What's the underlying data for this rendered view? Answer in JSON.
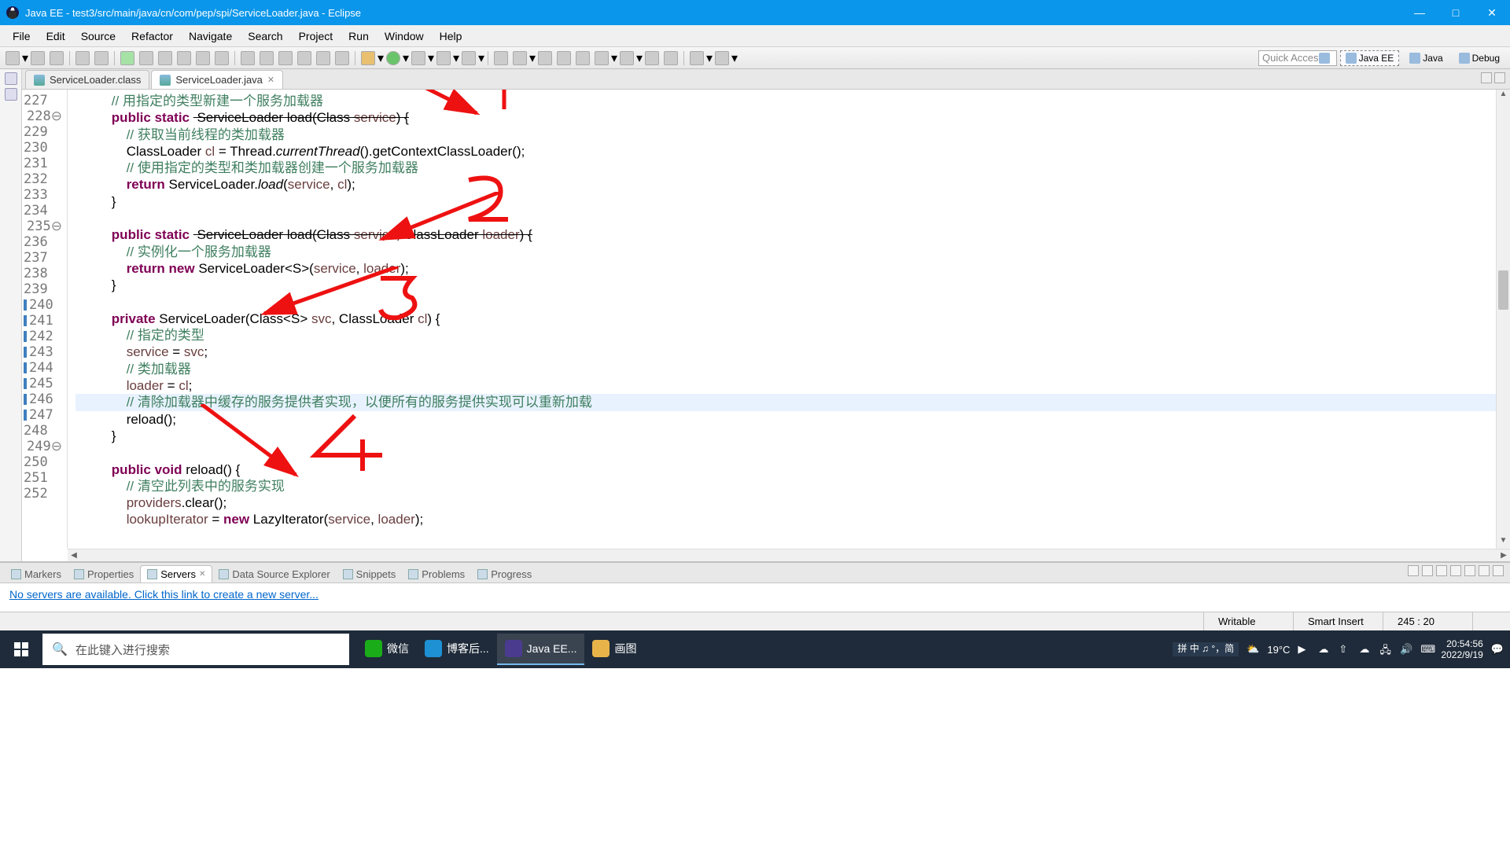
{
  "window": {
    "title": "Java EE - test3/src/main/java/cn/com/pep/spi/ServiceLoader.java - Eclipse"
  },
  "menu": [
    "File",
    "Edit",
    "Source",
    "Refactor",
    "Navigate",
    "Search",
    "Project",
    "Run",
    "Window",
    "Help"
  ],
  "quick_access_placeholder": "Quick Access",
  "perspectives": [
    {
      "label": "Java EE",
      "active": true
    },
    {
      "label": "Java",
      "active": false
    },
    {
      "label": "Debug",
      "active": false
    }
  ],
  "editor_tabs": [
    {
      "label": "ServiceLoader.class",
      "active": false
    },
    {
      "label": "ServiceLoader.java",
      "active": true
    }
  ],
  "code": {
    "first_line": 227,
    "highlight_line": 245,
    "lines": [
      {
        "n": 227,
        "indent": 2,
        "tokens": [
          [
            "cm",
            "// 用指定的类型新建一个服务加载器"
          ]
        ]
      },
      {
        "n": 228,
        "marker": "dot",
        "indent": 2,
        "tokens": [
          [
            "kw",
            "public"
          ],
          [
            "sp",
            " "
          ],
          [
            "kw",
            "static"
          ],
          [
            "sp",
            " <S> ServiceLoader<S> load(Class<S> "
          ],
          [
            "var",
            "service"
          ],
          [
            "tp",
            ") {"
          ]
        ]
      },
      {
        "n": 229,
        "indent": 3,
        "tokens": [
          [
            "cm",
            "// 获取当前线程的类加载器"
          ]
        ]
      },
      {
        "n": 230,
        "indent": 3,
        "tokens": [
          [
            "tp",
            "ClassLoader "
          ],
          [
            "var",
            "cl"
          ],
          [
            "tp",
            " = Thread."
          ],
          [
            "mtd",
            "currentThread"
          ],
          [
            "tp",
            "().getContextClassLoader();"
          ]
        ]
      },
      {
        "n": 231,
        "indent": 3,
        "tokens": [
          [
            "cm",
            "// 使用指定的类型和类加载器创建一个服务加载器"
          ]
        ]
      },
      {
        "n": 232,
        "indent": 3,
        "tokens": [
          [
            "kw",
            "return"
          ],
          [
            "tp",
            " ServiceLoader."
          ],
          [
            "mtd",
            "load"
          ],
          [
            "tp",
            "("
          ],
          [
            "var",
            "service"
          ],
          [
            "tp",
            ", "
          ],
          [
            "var",
            "cl"
          ],
          [
            "tp",
            ");"
          ]
        ]
      },
      {
        "n": 233,
        "indent": 2,
        "tokens": [
          [
            "tp",
            "}"
          ]
        ]
      },
      {
        "n": 234,
        "indent": 0,
        "tokens": []
      },
      {
        "n": 235,
        "marker": "dot",
        "indent": 2,
        "tokens": [
          [
            "kw",
            "public"
          ],
          [
            "sp",
            " "
          ],
          [
            "kw",
            "static"
          ],
          [
            "sp",
            " <S> ServiceLoader<S> load(Class<S> "
          ],
          [
            "var",
            "service"
          ],
          [
            "tp",
            ", ClassLoader "
          ],
          [
            "var",
            "loader"
          ],
          [
            "tp",
            ") {"
          ]
        ]
      },
      {
        "n": 236,
        "indent": 3,
        "tokens": [
          [
            "cm",
            "// 实例化一个服务加载器"
          ]
        ]
      },
      {
        "n": 237,
        "indent": 3,
        "tokens": [
          [
            "kw",
            "return"
          ],
          [
            "sp",
            " "
          ],
          [
            "kw",
            "new"
          ],
          [
            "tp",
            " ServiceLoader<S>("
          ],
          [
            "var",
            "service"
          ],
          [
            "tp",
            ", "
          ],
          [
            "var",
            "loader"
          ],
          [
            "tp",
            ");"
          ]
        ]
      },
      {
        "n": 238,
        "indent": 2,
        "tokens": [
          [
            "tp",
            "}"
          ]
        ]
      },
      {
        "n": 239,
        "indent": 0,
        "tokens": []
      },
      {
        "n": 240,
        "marker": "bar",
        "indent": 2,
        "tokens": [
          [
            "kw",
            "private"
          ],
          [
            "tp",
            " ServiceLoader(Class<S> "
          ],
          [
            "var",
            "svc"
          ],
          [
            "tp",
            ", ClassLoader "
          ],
          [
            "var",
            "cl"
          ],
          [
            "tp",
            ") {"
          ]
        ]
      },
      {
        "n": 241,
        "marker": "bar",
        "indent": 3,
        "tokens": [
          [
            "cm",
            "// 指定的类型"
          ]
        ]
      },
      {
        "n": 242,
        "marker": "bar",
        "indent": 3,
        "tokens": [
          [
            "var",
            "service"
          ],
          [
            "tp",
            " = "
          ],
          [
            "var",
            "svc"
          ],
          [
            "tp",
            ";"
          ]
        ]
      },
      {
        "n": 243,
        "marker": "bar",
        "indent": 3,
        "tokens": [
          [
            "cm",
            "// 类加载器"
          ]
        ]
      },
      {
        "n": 244,
        "marker": "bar",
        "indent": 3,
        "tokens": [
          [
            "var",
            "loader"
          ],
          [
            "tp",
            " = "
          ],
          [
            "var",
            "cl"
          ],
          [
            "tp",
            ";"
          ]
        ]
      },
      {
        "n": 245,
        "marker": "bar",
        "indent": 3,
        "tokens": [
          [
            "cm",
            "// 清除加载器中缓存的服务提供者实现，以便所有的服务提供实现可以重新加载"
          ]
        ]
      },
      {
        "n": 246,
        "marker": "bar",
        "indent": 3,
        "tokens": [
          [
            "tp",
            "reload();"
          ]
        ]
      },
      {
        "n": 247,
        "marker": "bar",
        "indent": 2,
        "tokens": [
          [
            "tp",
            "}"
          ]
        ]
      },
      {
        "n": 248,
        "indent": 0,
        "tokens": []
      },
      {
        "n": 249,
        "marker": "dot",
        "indent": 2,
        "tokens": [
          [
            "kw",
            "public"
          ],
          [
            "sp",
            " "
          ],
          [
            "kw",
            "void"
          ],
          [
            "tp",
            " reload() {"
          ]
        ]
      },
      {
        "n": 250,
        "indent": 3,
        "tokens": [
          [
            "cm",
            "// 清空此列表中的服务实现"
          ]
        ]
      },
      {
        "n": 251,
        "indent": 3,
        "tokens": [
          [
            "var",
            "providers"
          ],
          [
            "tp",
            ".clear();"
          ]
        ]
      },
      {
        "n": 252,
        "indent": 3,
        "tokens": [
          [
            "var",
            "lookupIterator"
          ],
          [
            "tp",
            " = "
          ],
          [
            "kw",
            "new"
          ],
          [
            "tp",
            " LazyIterator("
          ],
          [
            "var",
            "service"
          ],
          [
            "tp",
            ", "
          ],
          [
            "var",
            "loader"
          ],
          [
            "tp",
            ");"
          ]
        ]
      }
    ]
  },
  "bottom_tabs": [
    "Markers",
    "Properties",
    "Servers",
    "Data Source Explorer",
    "Snippets",
    "Problems",
    "Progress"
  ],
  "bottom_active": 2,
  "server_link": "No servers are available. Click this link to create a new server...",
  "status": {
    "writable": "Writable",
    "insert": "Smart Insert",
    "pos": "245 : 20"
  },
  "taskbar": {
    "search_placeholder": "在此键入进行搜索",
    "items": [
      {
        "label": "微信",
        "color": "#1aad19"
      },
      {
        "label": "博客后...",
        "color": "#1e90d4"
      },
      {
        "label": "Java EE...",
        "color": "#4a3b8f",
        "active": true
      },
      {
        "label": "画图",
        "color": "#e8b44a"
      }
    ],
    "ime": "拼 中 ♫ °，简",
    "weather": "19°C",
    "time": "20:54:56",
    "date": "2022/9/19"
  },
  "annotations": [
    "1",
    "2",
    "3",
    "4"
  ]
}
